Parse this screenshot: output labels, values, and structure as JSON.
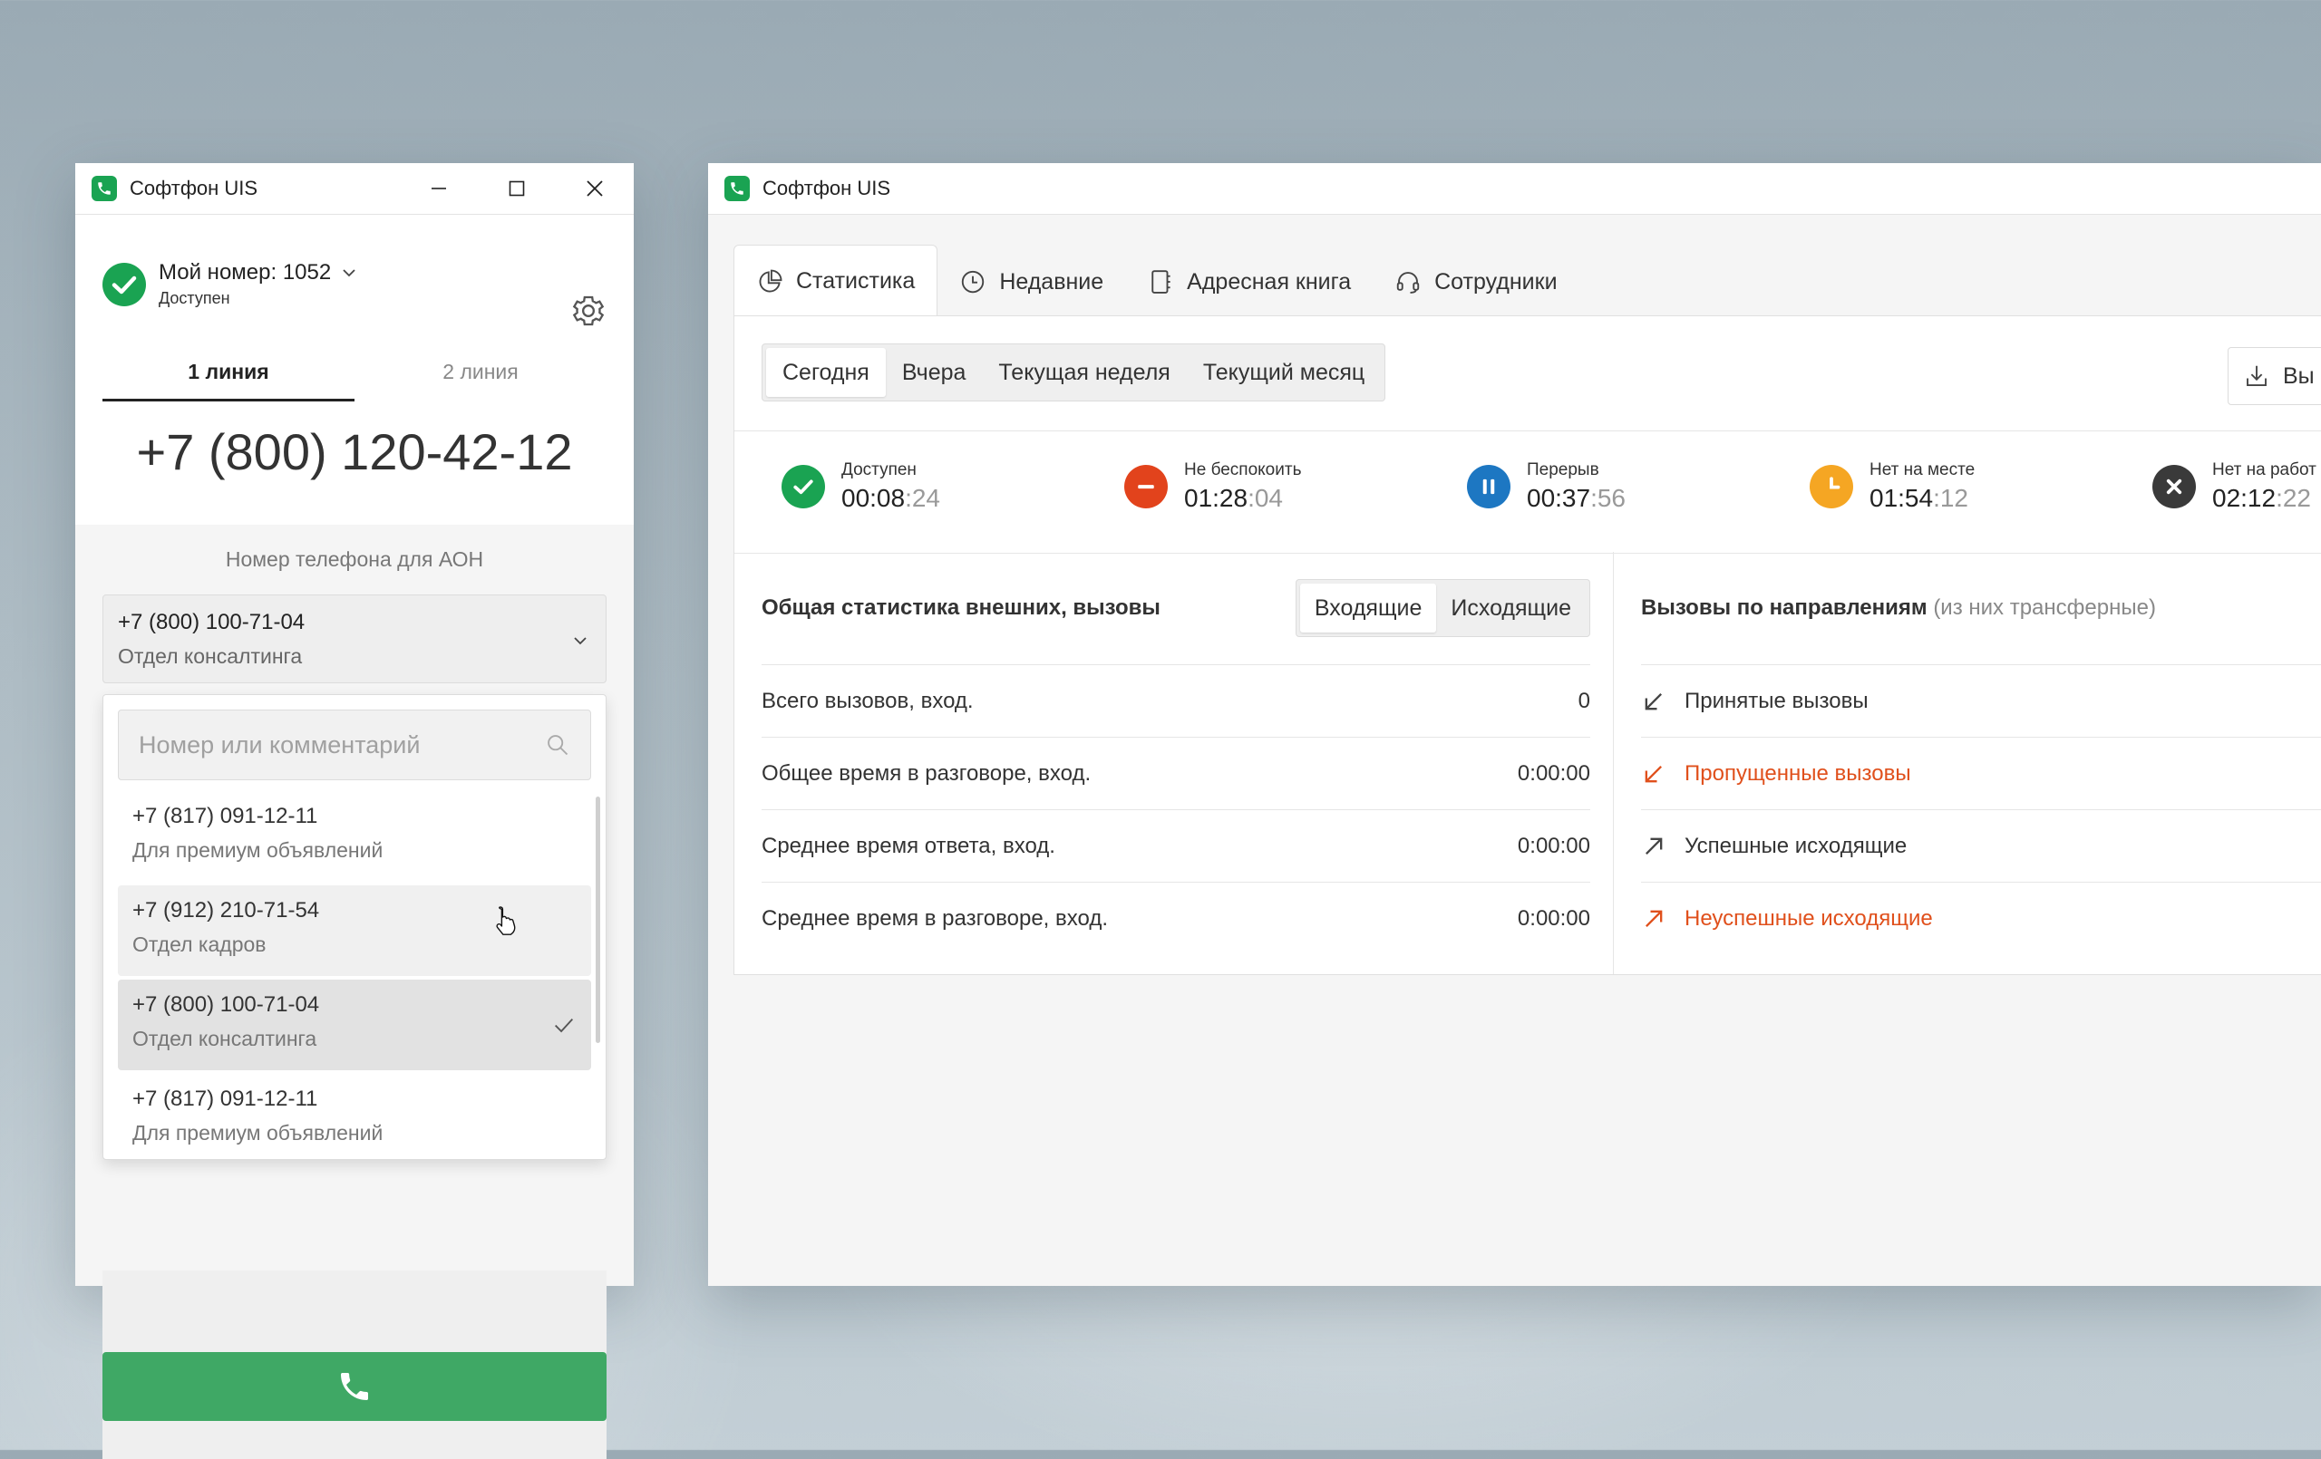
{
  "softphone": {
    "title": "Софтфон UIS",
    "my_number": "Мой номер: 1052",
    "status": "Доступен",
    "lines": [
      "1 линия",
      "2 линия"
    ],
    "dial_number": "+7 (800) 120-42-12",
    "aon_label": "Номер телефона для АОН",
    "aon_selected": {
      "number": "+7 (800) 100-71-04",
      "desc": "Отдел консалтинга"
    },
    "search_placeholder": "Номер или комментарий",
    "options": [
      {
        "number": "+7 (817) 091-12-11",
        "desc": "Для премиум объявлений"
      },
      {
        "number": "+7 (912) 210-71-54",
        "desc": "Отдел кадров"
      },
      {
        "number": "+7 (800) 100-71-04",
        "desc": "Отдел консалтинга"
      },
      {
        "number": "+7 (817) 091-12-11",
        "desc": "Для премиум объявлений"
      }
    ]
  },
  "stats_window": {
    "title": "Софтфон UIS",
    "tabs": [
      "Статистика",
      "Недавние",
      "Адресная книга",
      "Сотрудники"
    ],
    "periods": [
      "Сегодня",
      "Вчера",
      "Текущая неделя",
      "Текущий месяц"
    ],
    "export_label": "Вы",
    "statuses": [
      {
        "label": "Доступен",
        "time": "00:08",
        "sec": ":24",
        "color": "#1aa352"
      },
      {
        "label": "Не беспокоить",
        "time": "01:28",
        "sec": ":04",
        "color": "#e2431c"
      },
      {
        "label": "Перерыв",
        "time": "00:37",
        "sec": ":56",
        "color": "#1d77c2"
      },
      {
        "label": "Нет на месте",
        "time": "01:54",
        "sec": ":12",
        "color": "#f5a623"
      },
      {
        "label": "Нет на работ",
        "time": "02:12",
        "sec": ":22",
        "color": "#3a3a3a"
      }
    ],
    "general": {
      "title": "Общая статистика внешних, вызовы",
      "toggle": [
        "Входящие",
        "Исходящие"
      ],
      "rows": [
        {
          "label": "Всего вызовов, вход.",
          "value": "0"
        },
        {
          "label": "Общее время в разговоре, вход.",
          "value": "0:00:00"
        },
        {
          "label": "Среднее время ответа, вход.",
          "value": "0:00:00"
        },
        {
          "label": "Среднее время в разговоре, вход.",
          "value": "0:00:00"
        }
      ]
    },
    "directions": {
      "title": "Вызовы по направлениям",
      "title_muted": "(из них трансферные)",
      "rows": [
        {
          "label": "Принятые вызовы"
        },
        {
          "label": "Пропущенные вызовы"
        },
        {
          "label": "Успешные исходящие"
        },
        {
          "label": "Неуспешные исходящие"
        }
      ]
    }
  }
}
